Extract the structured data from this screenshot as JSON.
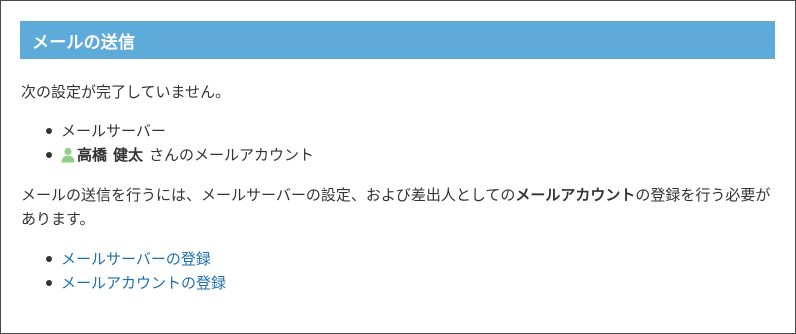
{
  "header": {
    "title": "メールの送信"
  },
  "notice": {
    "text": "次の設定が完了していません。"
  },
  "missing_settings": [
    {
      "label": "メールサーバー"
    },
    {
      "user_family_name": "高橋",
      "user_given_name": "健太",
      "suffix": "さんのメールアカウント",
      "icon": "user-icon"
    }
  ],
  "explanation": {
    "part1": "メールの送信を行うには、メールサーバーの設定、および差出人としての",
    "bold": "メールアカウント",
    "part2": "の登録を行う必要があります。"
  },
  "links": [
    {
      "label": "メールサーバーの登録"
    },
    {
      "label": "メールアカウントの登録"
    }
  ],
  "colors": {
    "header_bg": "#5eaad8",
    "link": "#1e6fb0",
    "user_icon": "#8fcf8a"
  }
}
